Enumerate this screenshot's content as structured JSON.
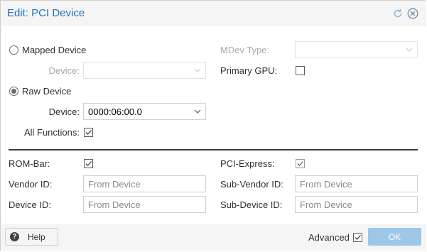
{
  "window": {
    "title": "Edit: PCI Device"
  },
  "tools": {
    "refresh_icon": "refresh-icon",
    "close_icon": "close-icon"
  },
  "mapped": {
    "label": "Mapped Device",
    "checked": false,
    "device_label": "Device:",
    "device_value": ""
  },
  "raw": {
    "label": "Raw Device",
    "checked": true,
    "device_label": "Device:",
    "device_value": "0000:06:00.0",
    "all_functions_label": "All Functions:",
    "all_functions_checked": true
  },
  "right_top": {
    "mdev_label": "MDev Type:",
    "mdev_value": "",
    "primary_gpu_label": "Primary GPU:",
    "primary_gpu_checked": false
  },
  "advanced_fields": {
    "rombar_label": "ROM-Bar:",
    "rombar_checked": true,
    "vendor_label": "Vendor ID:",
    "vendor_placeholder": "From Device",
    "device_id_label": "Device ID:",
    "device_id_placeholder": "From Device",
    "pcie_label": "PCI-Express:",
    "pcie_checked": true,
    "subvendor_label": "Sub-Vendor ID:",
    "subvendor_placeholder": "From Device",
    "subdevice_label": "Sub-Device ID:",
    "subdevice_placeholder": "From Device"
  },
  "footer": {
    "help_label": "Help",
    "advanced_label": "Advanced",
    "advanced_checked": true,
    "ok_label": "OK"
  },
  "colors": {
    "accent": "#1d73bd",
    "ok_disabled": "#9fc7e7"
  }
}
